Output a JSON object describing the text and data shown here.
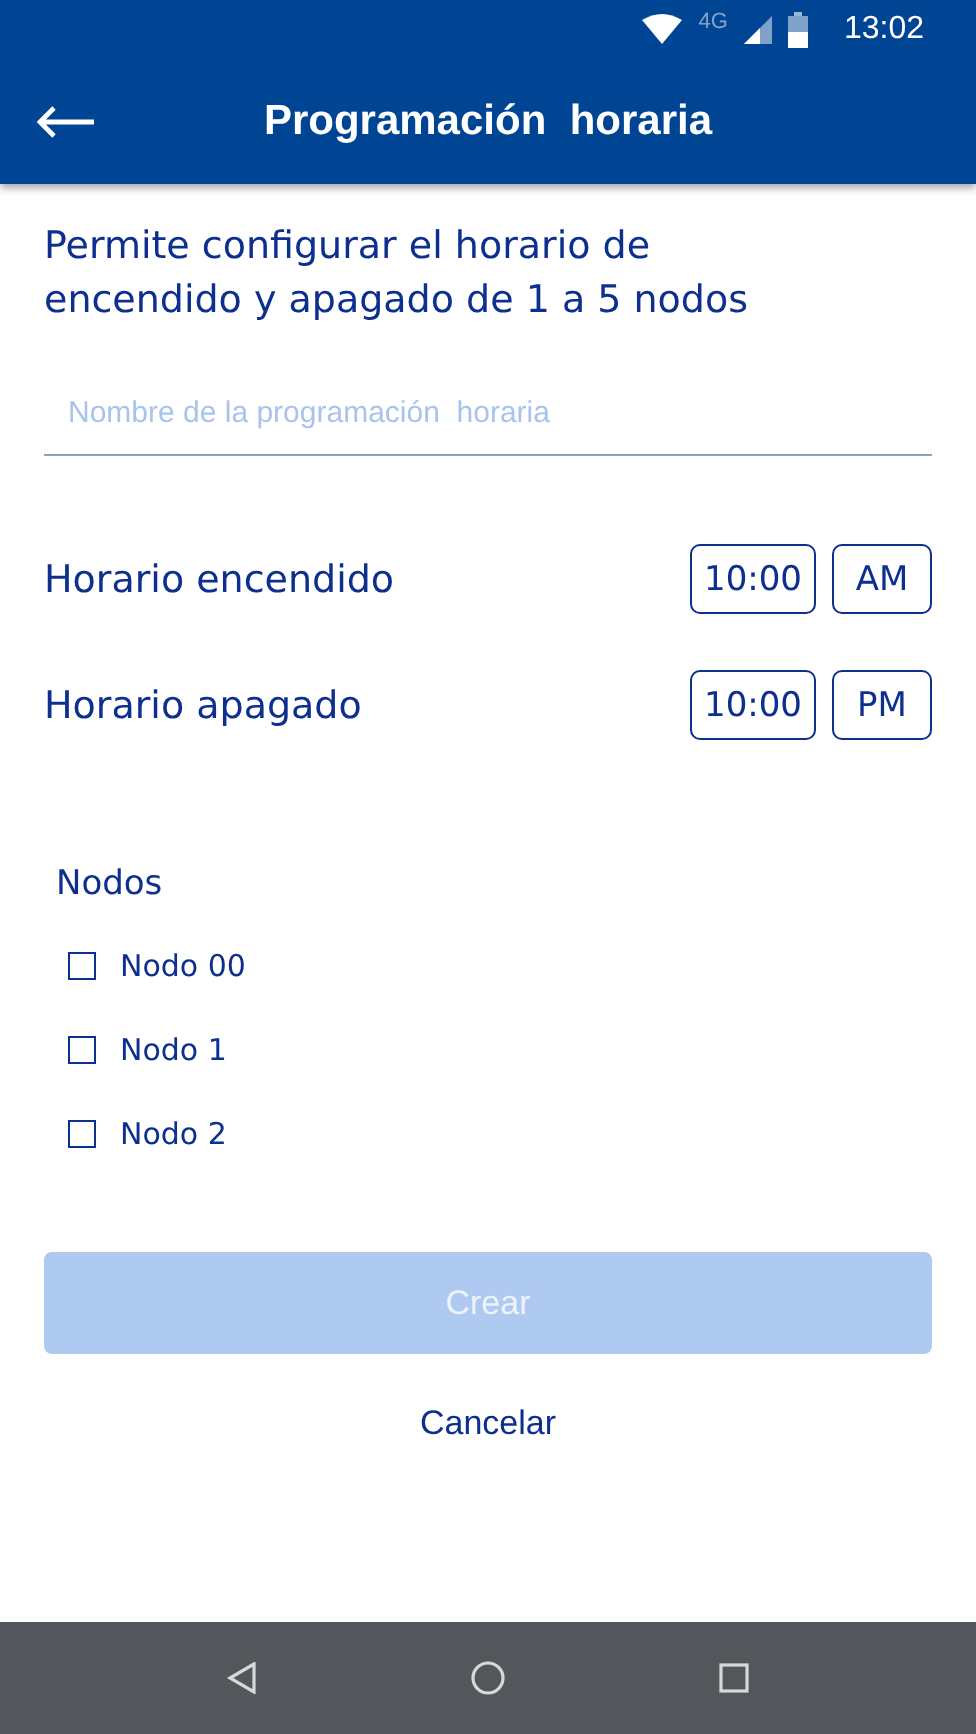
{
  "status_bar": {
    "network": "4G",
    "time": "13:02"
  },
  "app_bar": {
    "title": "Programación  horaria"
  },
  "description": "Permite configurar el horario de encendido y apagado de 1 a 5 nodos",
  "name_field": {
    "placeholder": "Nombre de la programación  horaria"
  },
  "schedules": [
    {
      "label": "Horario encendido",
      "time": "10:00",
      "period": "AM"
    },
    {
      "label": "Horario apagado",
      "time": "10:00",
      "period": "PM"
    }
  ],
  "nodes": {
    "title": "Nodos",
    "items": [
      {
        "label": "Nodo 00",
        "checked": false
      },
      {
        "label": "Nodo 1",
        "checked": false
      },
      {
        "label": "Nodo 2",
        "checked": false
      }
    ]
  },
  "create_button": {
    "label": "Crear",
    "disabled": true
  },
  "cancel_button": {
    "label": "Cancelar"
  }
}
